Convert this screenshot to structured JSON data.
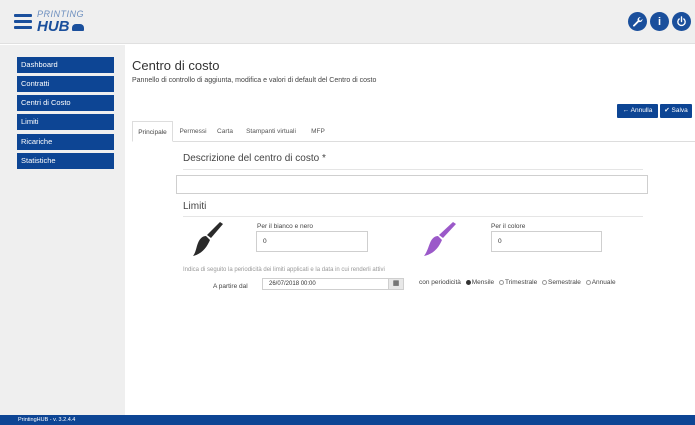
{
  "app": {
    "logo_line1": "PRINTING",
    "logo_line2": "HUB"
  },
  "topbar": {
    "icons": [
      "wrench-icon",
      "info-icon",
      "power-icon"
    ],
    "info_glyph": "i"
  },
  "sidebar": {
    "items": [
      {
        "label": "Dashboard"
      },
      {
        "label": "Contratti"
      },
      {
        "label": "Centri di Costo"
      },
      {
        "label": "Limiti"
      },
      {
        "label": "Ricariche"
      },
      {
        "label": "Statistiche"
      }
    ]
  },
  "header": {
    "title": "Centro di costo",
    "subtitle": "Pannello di controllo di aggiunta, modifica e valori di default del Centro di costo"
  },
  "actions": {
    "annulla_label": "Annulla",
    "salva_label": "Salva"
  },
  "tabs": [
    {
      "label": "Principale"
    },
    {
      "label": "Permessi"
    },
    {
      "label": "Carta"
    },
    {
      "label": "Stampanti virtuali"
    },
    {
      "label": "MFP"
    }
  ],
  "form": {
    "descrizione_title": "Descrizione del centro di costo *",
    "descrizione_value": "",
    "limiti_title": "Limiti",
    "bianco_nero_label": "Per il bianco e nero",
    "bianco_nero_value": "0",
    "colore_label": "Per il colore",
    "colore_value": "0",
    "periodicita_hint": "Indica di seguito la periodicità dei limiti applicati e la data in cui renderli attivi",
    "partire_label": "A partire dal",
    "partire_value": "26/07/2018 00:00",
    "periodicita_label": "con periodicità",
    "periodicita_options": [
      {
        "label": "Mensile",
        "checked": true
      },
      {
        "label": "Trimestrale",
        "checked": false
      },
      {
        "label": "Semestrale",
        "checked": false
      },
      {
        "label": "Annuale",
        "checked": false
      }
    ]
  },
  "colors": {
    "brand": "#0d4594",
    "brush_black": "#2a2a2a",
    "brush_purple": "#9b59c9"
  },
  "footer": {
    "version": "PrintingHUB - v. 3.2.4.4"
  }
}
